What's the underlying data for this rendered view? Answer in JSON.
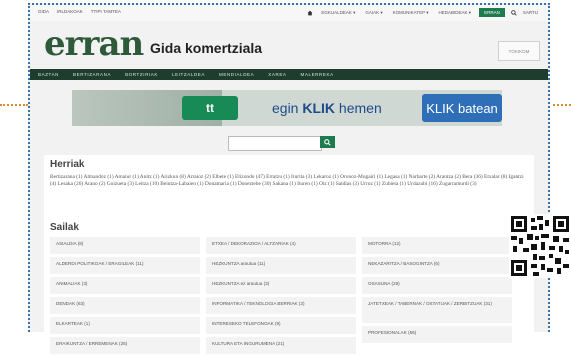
{
  "topbar": {
    "left_links": [
      "GIDA",
      "IRLDAKOAK",
      "TTIPI TAMTEA"
    ],
    "right_links": [
      "EGKUALDEAK ▾",
      "GAIAK ▾",
      "KOMUNIKATEP ▾",
      "HEDABIDEAK ▾"
    ],
    "highlight": "ERRAN",
    "extra": "SARTU"
  },
  "header": {
    "logo": "erran",
    "title": "Gida komertziala",
    "partner_logo": "TOKIKOM"
  },
  "nav": {
    "items": [
      "BAZTAN",
      "BERTIZARANA",
      "BORTZIRIAK",
      "LEITZALDEA",
      "MENDIALDEA",
      "XAREA",
      "MALERREKA"
    ]
  },
  "banner": {
    "app_label": "tt",
    "text_prefix": "egin ",
    "text_bold": "KLIK",
    "text_suffix": " hemen",
    "button": "KLIK batean"
  },
  "search": {
    "placeholder": "",
    "button_icon": "search-icon"
  },
  "herriak": {
    "title": "Herriak",
    "text": "Bertizarana (1) Almandoz (1) Amaiur (1) Anitz (1) Arizkun (8) Arraioz (2) Elbete (1) Elizondo (47) Erratzu (1) Irurita (3) Lekaroz (1) Oronoz-Mugairi (1) Legasa (1) Narbarte (2) Arantza (2) Bera (36) Etxalar (8) Igantzi (4) Lesaka (26) Arano (2) Goizueta (3) Leitza (10) Beintza-Labaien (1) Donamaria (1) Doneztebe (30) Sakana (1) Ituren (1) Oiz (1) Saldias (3) Urroz (1) Zubieta (1) Urdazubi (16) Zugarramurdi (3)"
  },
  "sailak": {
    "title": "Sailak",
    "col1": [
      "ASIALDIA (8)",
      "ALDERDI POLITIKOAK / ERAGILEAK (11)",
      "ANIMALIAK (3)",
      "DENDAK (83)",
      "ELKARTEAK (1)",
      "ERAIKUNTZA / ERREMENAK (25)"
    ],
    "col2": [
      "ETXEA / DEKORAZIOA / ALTZARIAK (4)",
      "HEZKUNTZA arautua (11)",
      "HEZKUNTZA ez arautua (3)",
      "INFORMATIKA / TEKNOLOGIA BERRIAK (3)",
      "INTERESEKO TELEFONOAK (9)",
      "KULTURA ETA INGURUMENA (21)"
    ],
    "col3": [
      "MOTORRA (12)",
      "NEKAZARITZA / BASOGINTZA (6)",
      "OSASUNA (28)",
      "JATETXEAK / TABERNAK / OSTATUAK / ZERBITZUAK (31)",
      "PROFESIONALAK (56)"
    ]
  },
  "colors": {
    "accent": "#1e7b4d",
    "nav_bg": "#1f3d2e",
    "frame_border": "#3a6fb0",
    "side_marker": "#e08a2e"
  }
}
